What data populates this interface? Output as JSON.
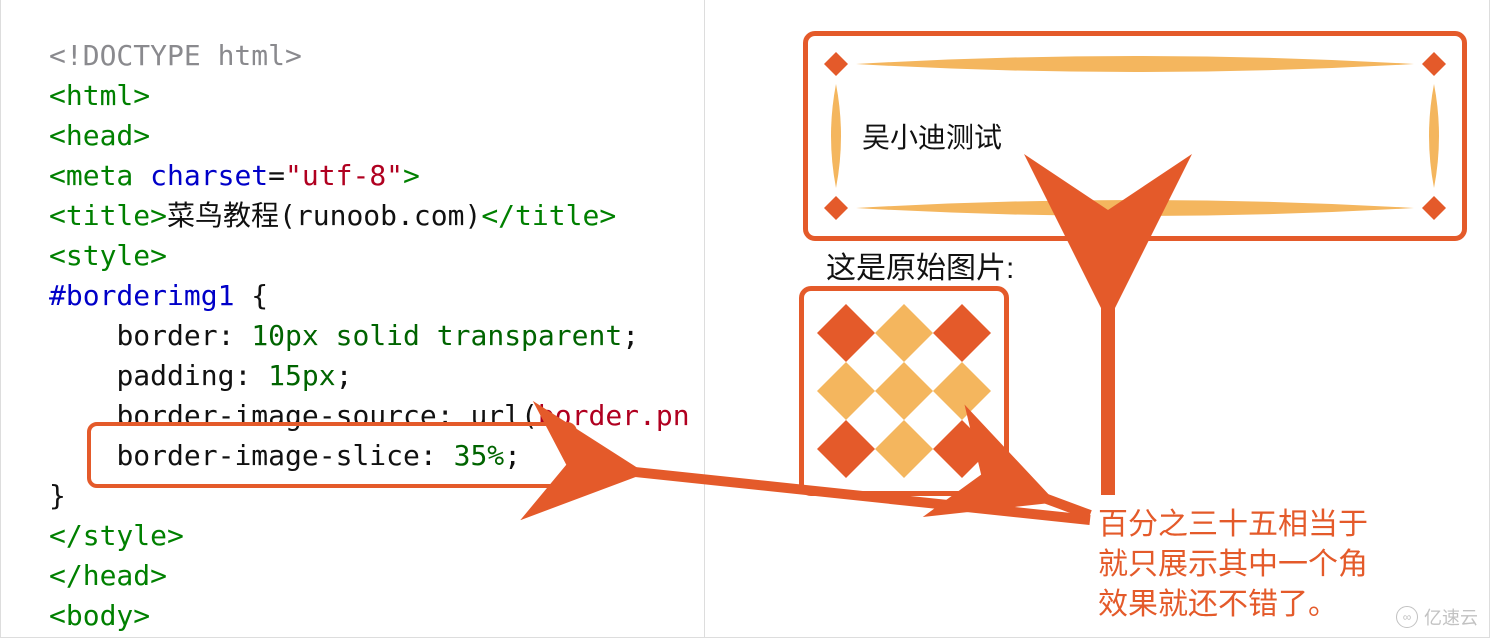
{
  "code": {
    "doctype": "<!DOCTYPE html>",
    "html_open": "<html>",
    "head_open": "<head>",
    "meta_tag": "meta",
    "meta_attr": "charset",
    "meta_val": "\"utf-8\"",
    "title_open": "<title>",
    "title_text": "菜鸟教程(runoob.com)",
    "title_close": "</title>",
    "style_open": "<style>",
    "selector": "#borderimg1",
    "brace_open": "{",
    "p1_prop": "border",
    "p1_v1": "10px",
    "p1_v2": "solid",
    "p1_v3": "transparent",
    "p2_prop": "padding",
    "p2_v1": "15px",
    "p3_prop": "border-image-source",
    "p3_func": "url",
    "p3_arg": "border.pn",
    "p4_prop": "border-image-slice",
    "p4_v1": "35%",
    "brace_close": "}",
    "style_close": "</style>",
    "head_close": "</head>",
    "body_open": "<body>",
    "indent": "    "
  },
  "demo_text": "吴小迪测试",
  "orig_label": "这是原始图片:",
  "annotation_l1": "百分之三十五相当于",
  "annotation_l2": "就只展示其中一个角",
  "annotation_l3": "效果就还不错了。",
  "watermark": "亿速云",
  "colors": {
    "darkOrange": "#e45a2a",
    "lightOrange": "#f4b65e"
  }
}
